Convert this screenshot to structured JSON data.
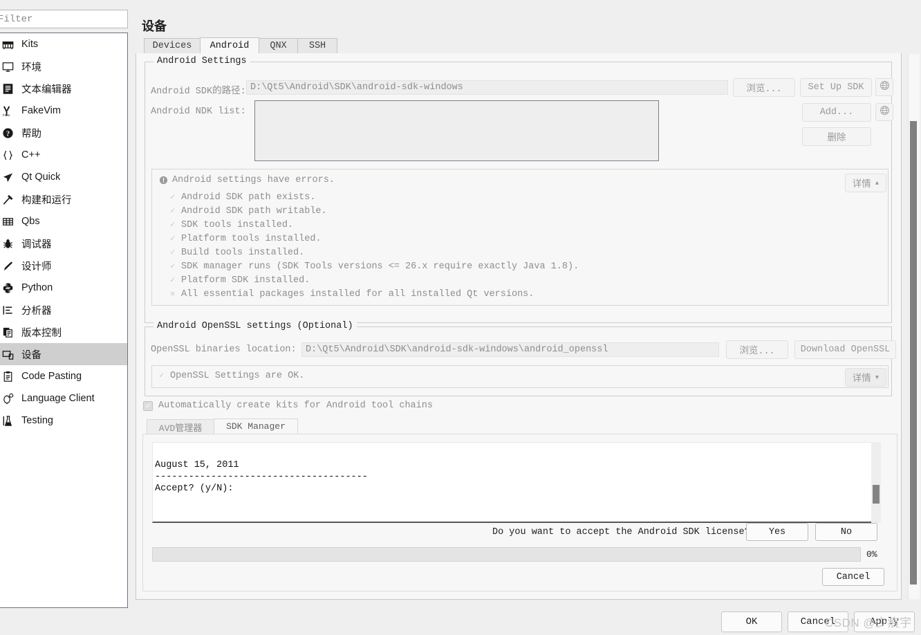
{
  "sidebar": {
    "filter_placeholder": "Filter",
    "filter_value": "",
    "items": [
      {
        "label": "Kits",
        "icon": "kits-icon",
        "selected": false
      },
      {
        "label": "环境",
        "icon": "monitor-icon",
        "selected": false
      },
      {
        "label": "文本编辑器",
        "icon": "text-editor-icon",
        "selected": false
      },
      {
        "label": "FakeVim",
        "icon": "fakevim-icon",
        "selected": false
      },
      {
        "label": "帮助",
        "icon": "help-question-icon",
        "selected": false
      },
      {
        "label": "C++",
        "icon": "braces-icon",
        "selected": false
      },
      {
        "label": "Qt Quick",
        "icon": "paper-plane-icon",
        "selected": false
      },
      {
        "label": "构建和运行",
        "icon": "hammer-icon",
        "selected": false
      },
      {
        "label": "Qbs",
        "icon": "grid-icon",
        "selected": false
      },
      {
        "label": "调试器",
        "icon": "bug-icon",
        "selected": false
      },
      {
        "label": "设计师",
        "icon": "pen-icon",
        "selected": false
      },
      {
        "label": "Python",
        "icon": "python-icon",
        "selected": false
      },
      {
        "label": "分析器",
        "icon": "analyzer-icon",
        "selected": false
      },
      {
        "label": "版本控制",
        "icon": "version-control-icon",
        "selected": false
      },
      {
        "label": "设备",
        "icon": "device-icon",
        "selected": true
      },
      {
        "label": "Code Pasting",
        "icon": "clipboard-icon",
        "selected": false
      },
      {
        "label": "Language Client",
        "icon": "language-client-icon",
        "selected": false
      },
      {
        "label": "Testing",
        "icon": "flask-icon",
        "selected": false
      }
    ]
  },
  "page": {
    "title": "设备",
    "tabs": [
      {
        "label": "Devices",
        "active": false
      },
      {
        "label": "Android",
        "active": true
      },
      {
        "label": "QNX",
        "active": false
      },
      {
        "label": "SSH",
        "active": false
      }
    ]
  },
  "android_settings": {
    "group_title": "Android Settings",
    "sdk_path_label": "Android SDK的路径:",
    "sdk_path_value": "D:\\Qt5\\Android\\SDK\\android-sdk-windows",
    "browse_label": "浏览...",
    "setup_sdk_label": "Set Up SDK",
    "ndk_list_label": "Android NDK list:",
    "ndk_items": [],
    "add_label": "Add...",
    "remove_label": "删除",
    "globe_icon": "globe-icon"
  },
  "issues": {
    "header": "Android settings have errors.",
    "header_icon": "alert-circle-icon",
    "details_label": "详情",
    "details_arrow": "▲",
    "rows": [
      {
        "mark": "✓",
        "text": "Android SDK path exists.",
        "ok": true
      },
      {
        "mark": "✓",
        "text": "Android SDK path writable.",
        "ok": true
      },
      {
        "mark": "✓",
        "text": "SDK tools installed.",
        "ok": true
      },
      {
        "mark": "✓",
        "text": "Platform tools installed.",
        "ok": true
      },
      {
        "mark": "✓",
        "text": "Build tools installed.",
        "ok": true
      },
      {
        "mark": "✓",
        "text": "SDK manager runs (SDK Tools versions <= 26.x require exactly Java 1.8).",
        "ok": true
      },
      {
        "mark": "✓",
        "text": "Platform SDK installed.",
        "ok": true
      },
      {
        "mark": "✕",
        "text": "All essential packages installed for all installed Qt versions.",
        "ok": false
      }
    ]
  },
  "openssl": {
    "group_title": "Android OpenSSL settings (Optional)",
    "location_label": "OpenSSL binaries location:",
    "location_value": "D:\\Qt5\\Android\\SDK\\android-sdk-windows\\android_openssl",
    "browse_label": "浏览...",
    "download_label": "Download OpenSSL",
    "status_mark": "✓",
    "status_text": "OpenSSL Settings are OK.",
    "details_label": "详情",
    "details_arrow": "▼"
  },
  "auto_kits": {
    "checked": true,
    "check_glyph": "✓",
    "label": "Automatically create kits for Android tool chains"
  },
  "sub_tabs": [
    {
      "label": "AVD管理器",
      "active": false
    },
    {
      "label": "SDK Manager",
      "active": true
    }
  ],
  "sdk_manager": {
    "license_text": "August 15, 2011\n--------------------------------------\nAccept? (y/N):",
    "question": "Do you want to accept the Android SDK license?",
    "yes_label": "Yes",
    "no_label": "No",
    "progress_percent": "0%",
    "progress_value": 0,
    "cancel_label": "Cancel"
  },
  "dialog_buttons": {
    "ok": "OK",
    "cancel": "Cancel",
    "apply": "Apply"
  },
  "watermark": "CSDN @少痕宇"
}
